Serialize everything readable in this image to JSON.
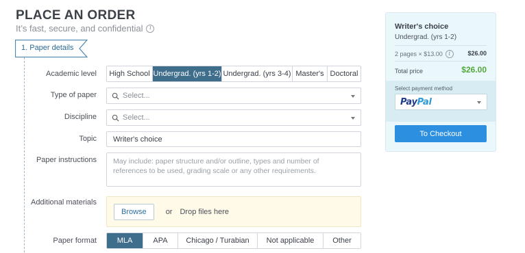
{
  "header": {
    "title": "PLACE AN ORDER",
    "subtitle": "It’s fast, secure, and confidential"
  },
  "step": {
    "label": "1.  Paper details"
  },
  "form": {
    "academic_level": {
      "label": "Academic level",
      "options": [
        "High School",
        "Undergrad. (yrs 1-2)",
        "Undergrad. (yrs 3-4)",
        "Master's",
        "Doctoral"
      ],
      "selected": "Undergrad. (yrs 1-2)"
    },
    "type_of_paper": {
      "label": "Type of paper",
      "placeholder": "Select..."
    },
    "discipline": {
      "label": "Discipline",
      "placeholder": "Select..."
    },
    "topic": {
      "label": "Topic",
      "value": "Writer's choice"
    },
    "instructions": {
      "label": "Paper instructions",
      "placeholder": "May include: paper structure and/or outline, types and number of references to be used, grading scale or any other requirements."
    },
    "materials": {
      "label": "Additional materials",
      "browse_label": "Browse",
      "or_text": "or",
      "drop_text": "Drop files here"
    },
    "paper_format": {
      "label": "Paper format",
      "options": [
        "MLA",
        "APA",
        "Chicago / Turabian",
        "Not applicable",
        "Other"
      ],
      "selected": "MLA"
    }
  },
  "summary": {
    "title": "Writer's choice",
    "level": "Undergrad. (yrs 1-2)",
    "pages_text": "2 pages × $13.00",
    "pages_total": "$26.00",
    "total_label": "Total price",
    "total_value": "$26.00",
    "payment_label": "Select payment method",
    "payment_selected": "PayPal",
    "checkout_label": "To Checkout"
  },
  "colors": {
    "active_segment": "#3f6d8c",
    "checkout_button": "#2c8fe0",
    "total_price": "#53a83a",
    "summary_bg": "#eaf8fc",
    "dropzone_bg": "#fffbe8"
  },
  "icons": {
    "info": "info-icon",
    "search": "search-icon",
    "dropdown": "chevron-down-icon"
  }
}
